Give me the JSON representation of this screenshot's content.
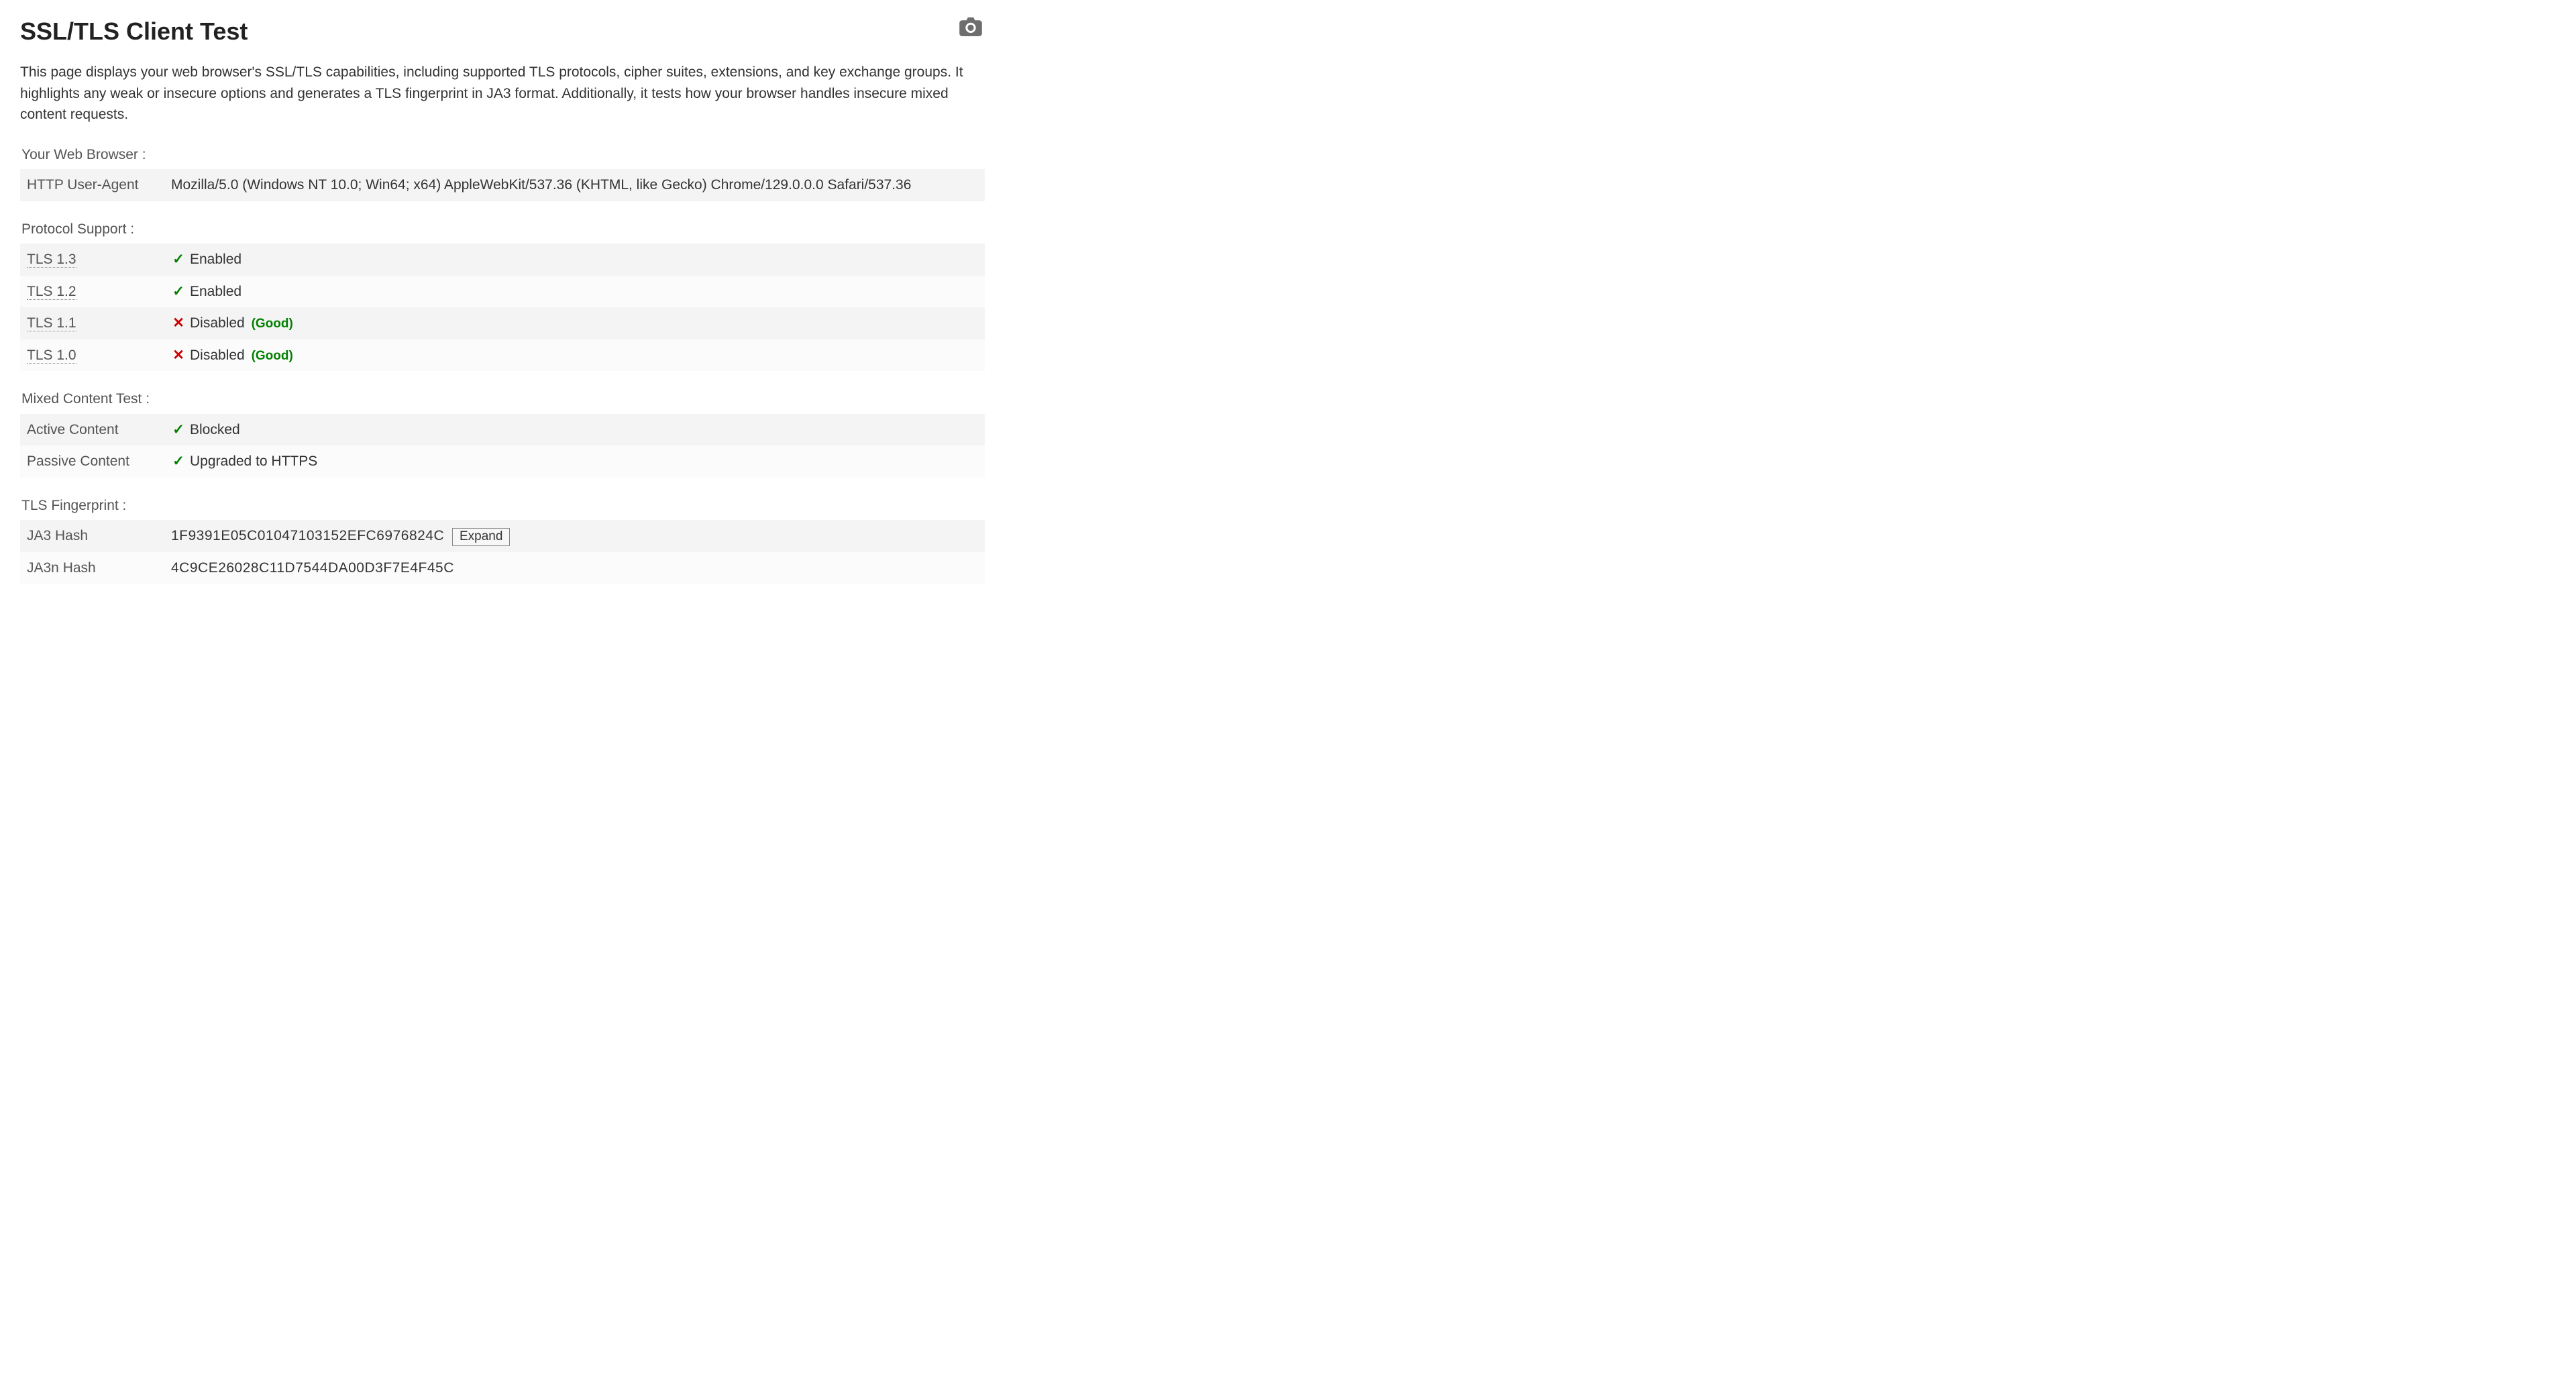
{
  "header": {
    "title": "SSL/TLS Client Test",
    "intro": "This page displays your web browser's SSL/TLS capabilities, including supported TLS protocols, cipher suites, extensions, and key exchange groups. It highlights any weak or insecure options and generates a TLS fingerprint in JA3 format. Additionally, it tests how your browser handles insecure mixed content requests.",
    "camera_icon": "camera"
  },
  "sections": {
    "browser": {
      "heading": "Your Web Browser :",
      "rows": [
        {
          "label": "HTTP User-Agent",
          "value": "Mozilla/5.0 (Windows NT 10.0; Win64; x64) AppleWebKit/537.36 (KHTML, like Gecko) Chrome/129.0.0.0 Safari/537.36"
        }
      ]
    },
    "protocol": {
      "heading": "Protocol Support :",
      "rows": [
        {
          "label": "TLS 1.3",
          "status": "Enabled",
          "icon": "check",
          "dotted": true
        },
        {
          "label": "TLS 1.2",
          "status": "Enabled",
          "icon": "check",
          "dotted": true
        },
        {
          "label": "TLS 1.1",
          "status": "Disabled",
          "icon": "cross",
          "dotted": true,
          "note": "(Good)"
        },
        {
          "label": "TLS 1.0",
          "status": "Disabled",
          "icon": "cross",
          "dotted": true,
          "note": "(Good)"
        }
      ]
    },
    "mixed": {
      "heading": "Mixed Content Test :",
      "rows": [
        {
          "label": "Active Content",
          "status": "Blocked",
          "icon": "check"
        },
        {
          "label": "Passive Content",
          "status": "Upgraded to HTTPS",
          "icon": "check"
        }
      ]
    },
    "fingerprint": {
      "heading": "TLS Fingerprint :",
      "rows": [
        {
          "label": "JA3 Hash",
          "value": "1F9391E05C01047103152EFC6976824C",
          "expand": true,
          "expand_label": "Expand"
        },
        {
          "label": "JA3n Hash",
          "value": "4C9CE26028C11D7544DA00D3F7E4F45C"
        }
      ]
    }
  }
}
